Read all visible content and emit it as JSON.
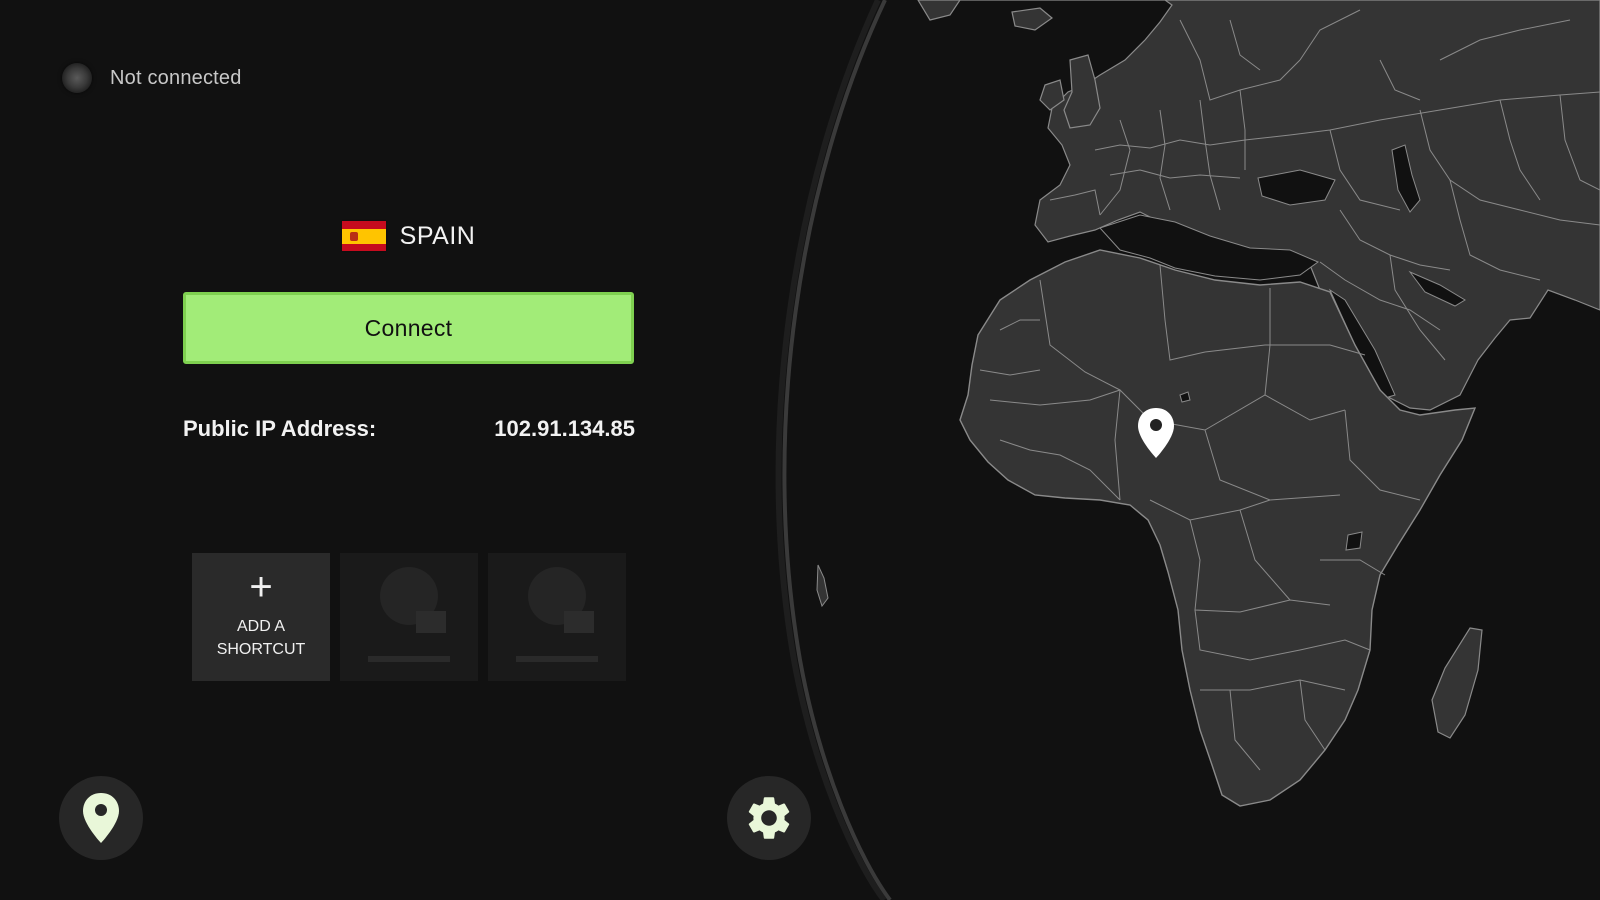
{
  "status": {
    "label": "Not connected"
  },
  "location": {
    "country": "SPAIN",
    "flag_icon": "spain-flag-icon"
  },
  "connect_button": {
    "label": "Connect"
  },
  "ip": {
    "label": "Public IP Address:",
    "value": "102.91.134.85"
  },
  "shortcuts": {
    "add_label": "ADD A SHORTCUT",
    "add_icon": "plus-icon"
  },
  "icons": {
    "locations": "map-pin-icon",
    "settings": "gear-icon",
    "map_marker": "map-marker-icon"
  },
  "colors": {
    "background": "#111111",
    "connect_button": "#a2ec78",
    "land": "#363636",
    "borders": "#8a8a8a"
  }
}
